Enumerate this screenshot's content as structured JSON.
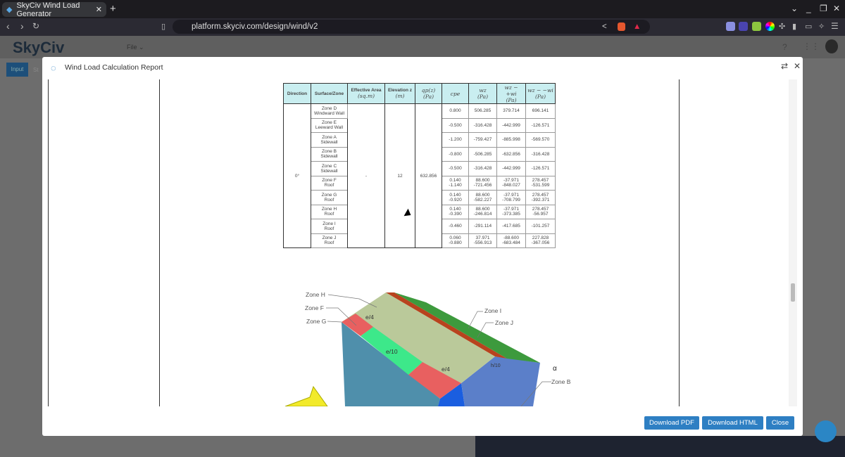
{
  "browser": {
    "tab_title": "SkyCiv Wind Load Generator",
    "url": "platform.skyciv.com/design/wind/v2"
  },
  "app": {
    "logo": "SkyCiv",
    "file_menu": "File",
    "input_tab": "Input",
    "second_tab": "St"
  },
  "modal": {
    "title": "Wind Load Calculation Report",
    "headers": [
      "Direction",
      "Surface/Zone",
      "Effective Area",
      "Elevation z",
      "qp(z)",
      "cpe",
      "wz",
      "wz − +wi",
      "wz − −wi"
    ],
    "header_units": [
      "",
      "",
      "(sq.m)",
      "(m)",
      "(Pa)",
      "",
      "(Pa)",
      "(Pa)",
      "(Pa)"
    ],
    "direction": "0°",
    "effective_area": "-",
    "elevation": "12",
    "qp": "632.856",
    "rows": [
      {
        "zone": "Zone D",
        "surface": "Windward Wall",
        "cpe": "0.800",
        "wz": "506.285",
        "wpos": "379.714",
        "wneg": "696.141"
      },
      {
        "zone": "Zone E",
        "surface": "Leeward Wall",
        "cpe": "-0.500",
        "wz": "-316.428",
        "wpos": "-442.999",
        "wneg": "-126.571"
      },
      {
        "zone": "Zone A",
        "surface": "Sidewall",
        "cpe": "-1.200",
        "wz": "-759.427",
        "wpos": "-885.998",
        "wneg": "-569.570"
      },
      {
        "zone": "Zone B",
        "surface": "Sidewall",
        "cpe": "-0.800",
        "wz": "-506.285",
        "wpos": "-632.856",
        "wneg": "-316.428"
      },
      {
        "zone": "Zone C",
        "surface": "Sidewall",
        "cpe": "-0.500",
        "wz": "-316.428",
        "wpos": "-442.999",
        "wneg": "-126.571"
      },
      {
        "zone": "Zone F",
        "surface": "Roof",
        "cpe": "0.140 -1.140",
        "wz": "88.600 -721.456",
        "wpos": "-37.971 -848.027",
        "wneg": "278.457 -531.599"
      },
      {
        "zone": "Zone G",
        "surface": "Roof",
        "cpe": "0.140 -0.920",
        "wz": "88.600 -582.227",
        "wpos": "-37.971 -708.799",
        "wneg": "278.457 -392.371"
      },
      {
        "zone": "Zone H",
        "surface": "Roof",
        "cpe": "0.140 -0.390",
        "wz": "88.600 -246.814",
        "wpos": "-37.971 -373.385",
        "wneg": "278.457 -56.957"
      },
      {
        "zone": "Zone I",
        "surface": "Roof",
        "cpe": "-0.460",
        "wz": "-291.114",
        "wpos": "-417.685",
        "wneg": "-101.257"
      },
      {
        "zone": "Zone J",
        "surface": "Roof",
        "cpe": "0.060 -0.880",
        "wz": "37.971 -556.913",
        "wpos": "-88.600 -683.484",
        "wneg": "227.828 -367.056"
      }
    ],
    "diagram": {
      "labels": {
        "h": "Zone H",
        "f": "Zone F",
        "g": "Zone G",
        "i": "Zone I",
        "j": "Zone J",
        "b": "Zone B",
        "e4a": "e/4",
        "e10": "e/10",
        "e4b": "e/4",
        "h10": "h/10",
        "alpha": "α"
      }
    },
    "buttons": {
      "pdf": "Download PDF",
      "html": "Download HTML",
      "close": "Close"
    }
  },
  "colors": {
    "accent": "#2e7fc3",
    "table_header": "#c9eef0"
  }
}
